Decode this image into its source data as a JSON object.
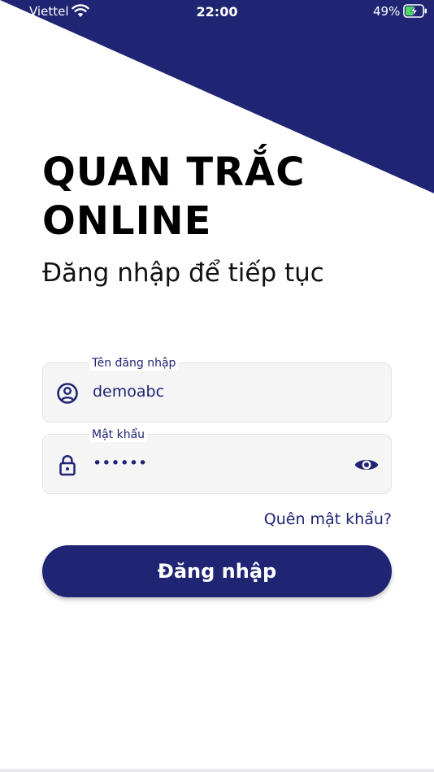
{
  "status_bar": {
    "carrier": "Viettel",
    "time": "22:00",
    "battery_percent": "49%"
  },
  "colors": {
    "primary": "#1f2473",
    "field_background": "#f5f5f5",
    "text": "#000000"
  },
  "header": {
    "title_line1": "QUAN TRẮC",
    "title_line2": "ONLINE",
    "subtitle": "Đăng nhập để tiếp tục"
  },
  "form": {
    "username": {
      "label": "Tên đăng nhập",
      "value": "demoabc",
      "icon": "user-circle-icon"
    },
    "password": {
      "label": "Mật khẩu",
      "value": "••••••",
      "icon": "lock-icon",
      "toggle_icon": "eye-icon"
    },
    "forgot_password": "Quên mật khẩu?",
    "login_button": "Đăng nhập"
  }
}
